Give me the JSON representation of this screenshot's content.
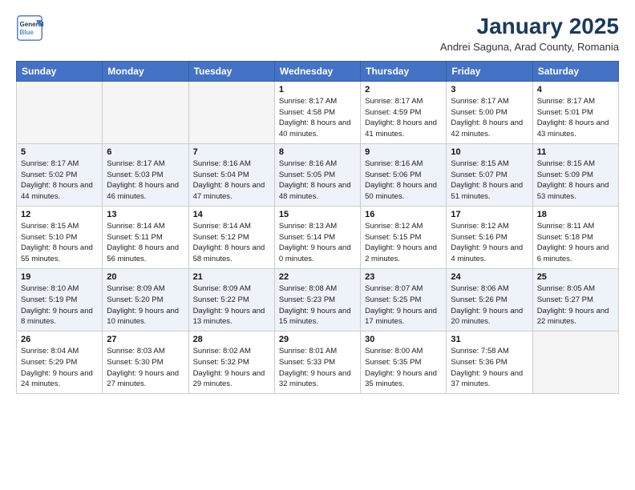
{
  "header": {
    "logo_line1": "General",
    "logo_line2": "Blue",
    "month": "January 2025",
    "location": "Andrei Saguna, Arad County, Romania"
  },
  "weekdays": [
    "Sunday",
    "Monday",
    "Tuesday",
    "Wednesday",
    "Thursday",
    "Friday",
    "Saturday"
  ],
  "weeks": [
    [
      {
        "day": "",
        "empty": true
      },
      {
        "day": "",
        "empty": true
      },
      {
        "day": "",
        "empty": true
      },
      {
        "day": "1",
        "sunrise": "8:17 AM",
        "sunset": "4:58 PM",
        "daylight": "8 hours and 40 minutes."
      },
      {
        "day": "2",
        "sunrise": "8:17 AM",
        "sunset": "4:59 PM",
        "daylight": "8 hours and 41 minutes."
      },
      {
        "day": "3",
        "sunrise": "8:17 AM",
        "sunset": "5:00 PM",
        "daylight": "8 hours and 42 minutes."
      },
      {
        "day": "4",
        "sunrise": "8:17 AM",
        "sunset": "5:01 PM",
        "daylight": "8 hours and 43 minutes."
      }
    ],
    [
      {
        "day": "5",
        "sunrise": "8:17 AM",
        "sunset": "5:02 PM",
        "daylight": "8 hours and 44 minutes."
      },
      {
        "day": "6",
        "sunrise": "8:17 AM",
        "sunset": "5:03 PM",
        "daylight": "8 hours and 46 minutes."
      },
      {
        "day": "7",
        "sunrise": "8:16 AM",
        "sunset": "5:04 PM",
        "daylight": "8 hours and 47 minutes."
      },
      {
        "day": "8",
        "sunrise": "8:16 AM",
        "sunset": "5:05 PM",
        "daylight": "8 hours and 48 minutes."
      },
      {
        "day": "9",
        "sunrise": "8:16 AM",
        "sunset": "5:06 PM",
        "daylight": "8 hours and 50 minutes."
      },
      {
        "day": "10",
        "sunrise": "8:15 AM",
        "sunset": "5:07 PM",
        "daylight": "8 hours and 51 minutes."
      },
      {
        "day": "11",
        "sunrise": "8:15 AM",
        "sunset": "5:09 PM",
        "daylight": "8 hours and 53 minutes."
      }
    ],
    [
      {
        "day": "12",
        "sunrise": "8:15 AM",
        "sunset": "5:10 PM",
        "daylight": "8 hours and 55 minutes."
      },
      {
        "day": "13",
        "sunrise": "8:14 AM",
        "sunset": "5:11 PM",
        "daylight": "8 hours and 56 minutes."
      },
      {
        "day": "14",
        "sunrise": "8:14 AM",
        "sunset": "5:12 PM",
        "daylight": "8 hours and 58 minutes."
      },
      {
        "day": "15",
        "sunrise": "8:13 AM",
        "sunset": "5:14 PM",
        "daylight": "9 hours and 0 minutes."
      },
      {
        "day": "16",
        "sunrise": "8:12 AM",
        "sunset": "5:15 PM",
        "daylight": "9 hours and 2 minutes."
      },
      {
        "day": "17",
        "sunrise": "8:12 AM",
        "sunset": "5:16 PM",
        "daylight": "9 hours and 4 minutes."
      },
      {
        "day": "18",
        "sunrise": "8:11 AM",
        "sunset": "5:18 PM",
        "daylight": "9 hours and 6 minutes."
      }
    ],
    [
      {
        "day": "19",
        "sunrise": "8:10 AM",
        "sunset": "5:19 PM",
        "daylight": "9 hours and 8 minutes."
      },
      {
        "day": "20",
        "sunrise": "8:09 AM",
        "sunset": "5:20 PM",
        "daylight": "9 hours and 10 minutes."
      },
      {
        "day": "21",
        "sunrise": "8:09 AM",
        "sunset": "5:22 PM",
        "daylight": "9 hours and 13 minutes."
      },
      {
        "day": "22",
        "sunrise": "8:08 AM",
        "sunset": "5:23 PM",
        "daylight": "9 hours and 15 minutes."
      },
      {
        "day": "23",
        "sunrise": "8:07 AM",
        "sunset": "5:25 PM",
        "daylight": "9 hours and 17 minutes."
      },
      {
        "day": "24",
        "sunrise": "8:06 AM",
        "sunset": "5:26 PM",
        "daylight": "9 hours and 20 minutes."
      },
      {
        "day": "25",
        "sunrise": "8:05 AM",
        "sunset": "5:27 PM",
        "daylight": "9 hours and 22 minutes."
      }
    ],
    [
      {
        "day": "26",
        "sunrise": "8:04 AM",
        "sunset": "5:29 PM",
        "daylight": "9 hours and 24 minutes."
      },
      {
        "day": "27",
        "sunrise": "8:03 AM",
        "sunset": "5:30 PM",
        "daylight": "9 hours and 27 minutes."
      },
      {
        "day": "28",
        "sunrise": "8:02 AM",
        "sunset": "5:32 PM",
        "daylight": "9 hours and 29 minutes."
      },
      {
        "day": "29",
        "sunrise": "8:01 AM",
        "sunset": "5:33 PM",
        "daylight": "9 hours and 32 minutes."
      },
      {
        "day": "30",
        "sunrise": "8:00 AM",
        "sunset": "5:35 PM",
        "daylight": "9 hours and 35 minutes."
      },
      {
        "day": "31",
        "sunrise": "7:58 AM",
        "sunset": "5:36 PM",
        "daylight": "9 hours and 37 minutes."
      },
      {
        "day": "",
        "empty": true
      }
    ]
  ]
}
